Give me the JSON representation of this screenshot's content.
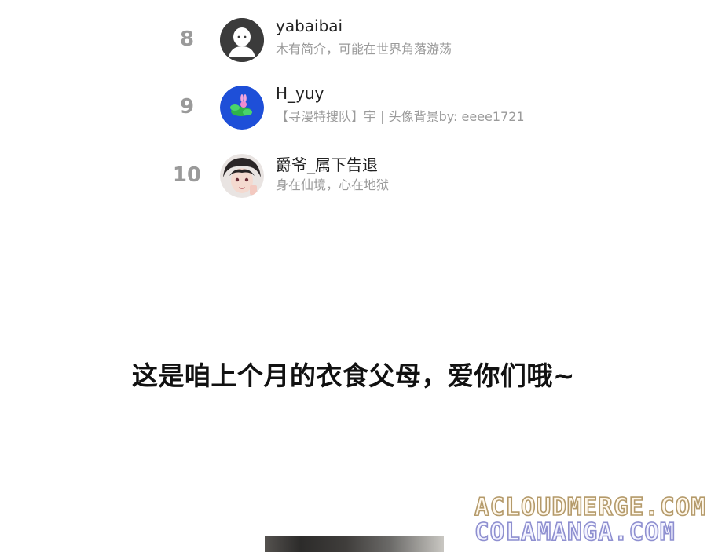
{
  "ranking": [
    {
      "rank": "8",
      "name": "yabaibai",
      "bio": "木有简介，可能在世界角落游荡",
      "avatar": "default-avatar-icon"
    },
    {
      "rank": "9",
      "name": "H_yuy",
      "bio": "【寻漫特搜队】宇 | 头像背景by: eeee1721",
      "avatar": "bunny-avatar"
    },
    {
      "rank": "10",
      "name": "爵爷_属下告退",
      "bio": "身在仙境，心在地狱",
      "avatar": "anime-boy-avatar"
    }
  ],
  "banner_text": "这是咱上个月的衣食父母，爱你们哦~",
  "watermark": {
    "line1": "ACLOUDMERGE.COM",
    "line2": "COLAMANGA.COM"
  },
  "colors": {
    "rank": "#9a9a9a",
    "bio": "#9a9a9a",
    "name": "#222222"
  }
}
